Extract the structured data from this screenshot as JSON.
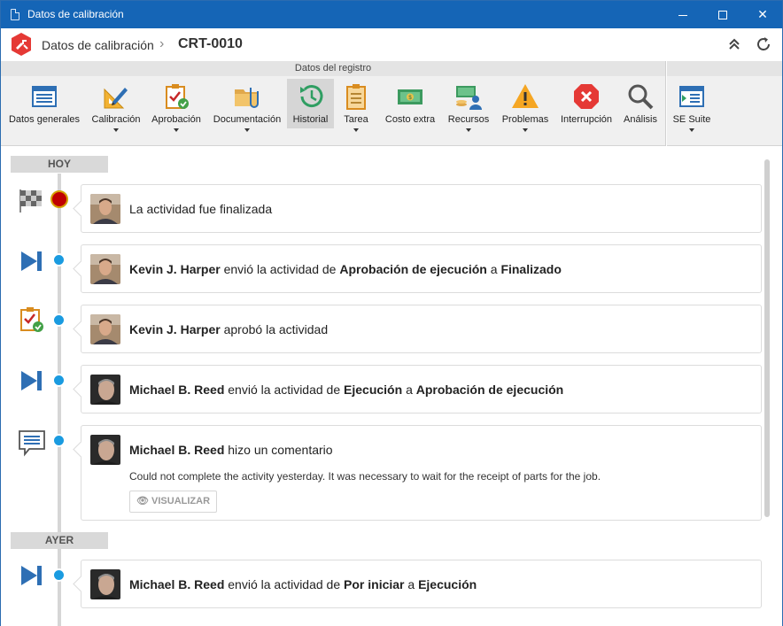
{
  "window": {
    "title": "Datos de calibración"
  },
  "header": {
    "breadcrumb_root": "Datos de calibración",
    "record_id": "CRT-0010"
  },
  "ribbon": {
    "group_label": "Datos del registro",
    "tools": [
      {
        "label": "Datos generales",
        "icon": "form-icon",
        "dropdown": false
      },
      {
        "label": "Calibración",
        "icon": "ruler-pencil-icon",
        "dropdown": true
      },
      {
        "label": "Aprobación",
        "icon": "clipboard-check-icon",
        "dropdown": true
      },
      {
        "label": "Documentación",
        "icon": "folder-clip-icon",
        "dropdown": true
      },
      {
        "label": "Historial",
        "icon": "history-clock-icon",
        "dropdown": false,
        "active": true
      },
      {
        "label": "Tarea",
        "icon": "clipboard-icon",
        "dropdown": true
      },
      {
        "label": "Costo extra",
        "icon": "money-icon",
        "dropdown": false
      },
      {
        "label": "Recursos",
        "icon": "resources-icon",
        "dropdown": true
      },
      {
        "label": "Problemas",
        "icon": "warning-icon",
        "dropdown": true
      },
      {
        "label": "Interrupción",
        "icon": "stop-icon",
        "dropdown": false
      },
      {
        "label": "Análisis",
        "icon": "magnifier-icon",
        "dropdown": false
      },
      {
        "label": "SE Suite",
        "icon": "suite-icon",
        "dropdown": true
      }
    ]
  },
  "timeline": {
    "today_label": "HOY",
    "yesterday_label": "AYER",
    "events": [
      {
        "type": "finished",
        "text": "La actividad fue finalizada"
      },
      {
        "type": "sent",
        "user": "Kevin J. Harper",
        "verb": "envió la actividad de",
        "from": "Aprobación de ejecución",
        "connector": "a",
        "to": "Finalizado"
      },
      {
        "type": "approved",
        "user": "Kevin J. Harper",
        "verb": "aprobó la actividad"
      },
      {
        "type": "sent",
        "user": "Michael B. Reed",
        "verb": "envió la actividad de",
        "from": "Ejecución",
        "connector": "a",
        "to": "Aprobación de ejecución"
      },
      {
        "type": "comment",
        "user": "Michael B. Reed",
        "verb": "hizo un comentario",
        "comment": "Could not complete the activity yesterday. It was necessary to wait for the receipt of parts for the job.",
        "view_label": "VISUALIZAR"
      },
      {
        "type": "sent",
        "user": "Michael B. Reed",
        "verb": "envió la actividad de",
        "from": "Por iniciar",
        "connector": "a",
        "to": "Ejecución"
      }
    ]
  },
  "colors": {
    "titlebar": "#1565b6",
    "dot": "#1a9be0",
    "finish_dot": "#c00000",
    "accent_blue": "#2e6fb4"
  }
}
